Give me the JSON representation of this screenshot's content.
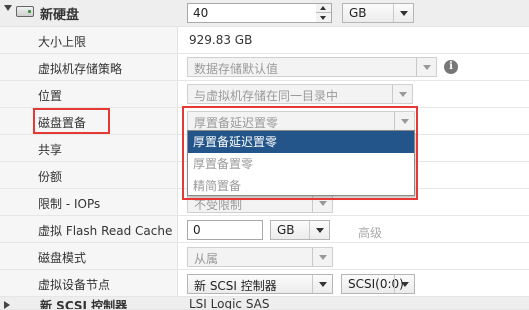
{
  "new_disk": {
    "label": "新硬盘",
    "size_value": "40",
    "size_unit": "GB"
  },
  "max_size": {
    "label": "大小上限",
    "value": "929.83 GB"
  },
  "storage_policy": {
    "label": "虚拟机存储策略",
    "value": "数据存储默认值"
  },
  "location": {
    "label": "位置",
    "value": "与虚拟机存储在同一目录中"
  },
  "provisioning": {
    "label": "磁盘置备",
    "value": "厚置备延迟置零",
    "options": [
      "厚置备延迟置零",
      "厚置备置零",
      "精简置备"
    ],
    "selected_index": 0
  },
  "sharing": {
    "label": "共享"
  },
  "shares": {
    "label": "份额"
  },
  "limit_iops": {
    "label": "限制 - IOPs",
    "value": "不受限制"
  },
  "flash_read_cache": {
    "label": "虚拟 Flash Read Cache",
    "value": "0",
    "unit": "GB",
    "advanced_label": "高级"
  },
  "disk_mode": {
    "label": "磁盘模式",
    "value": "从属"
  },
  "virtual_device_node": {
    "label": "虚拟设备节点",
    "controller": "新 SCSI 控制器",
    "node": "SCSI(0:0)"
  },
  "next_row": {
    "label": "新 SCSI 控制器",
    "value": "LSI Logic SAS"
  },
  "colors": {
    "highlight": "#e53935",
    "selected_option_bg": "#23558a"
  },
  "icons": {
    "collapse": "triangle-down-icon",
    "disk": "hard-disk-icon",
    "info": "info-icon"
  }
}
